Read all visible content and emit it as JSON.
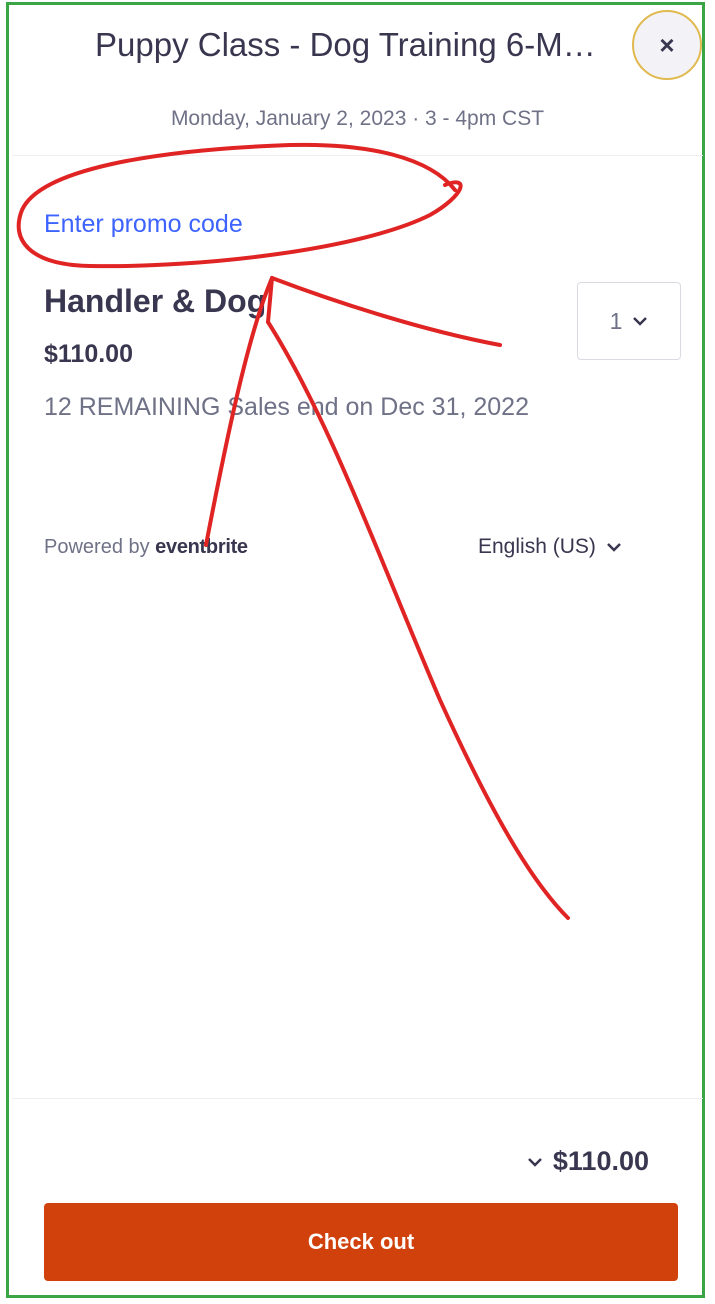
{
  "header": {
    "title": "Puppy Class - Dog Training 6-M…",
    "subtitle": "Monday, January 2, 2023 · 3 - 4pm CST",
    "close_label": "×"
  },
  "promo": {
    "link_label": "Enter promo code"
  },
  "ticket": {
    "name": "Handler & Dog",
    "price": "$110.00",
    "remaining": "12 REMAINING  Sales end on Dec 31, 2022",
    "quantity": "1"
  },
  "footer_info": {
    "powered_by": "Powered by ",
    "brand": "eventbrite",
    "language": "English (US)"
  },
  "checkout": {
    "total": "$110.00",
    "button_label": "Check out",
    "button_color": "#d1410c"
  },
  "colors": {
    "frame": "#3aa544",
    "annotation": "#e02424",
    "link": "#3d64ff"
  }
}
